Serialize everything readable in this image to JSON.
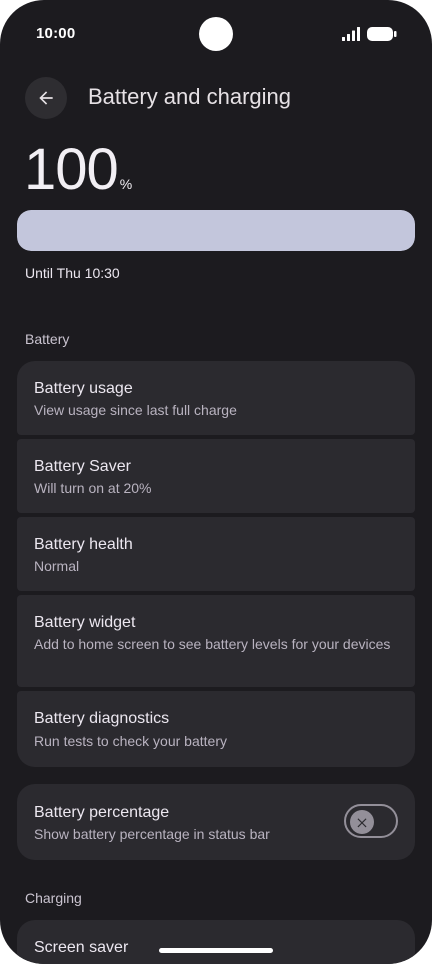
{
  "status_bar": {
    "time": "10:00"
  },
  "header": {
    "title": "Battery and charging",
    "back_icon": "arrow-back-icon"
  },
  "battery": {
    "level_value": "100",
    "level_unit": "%",
    "level_fraction": 1.0,
    "until_text": "Until Thu 10:30",
    "fill_color": "#c3c6dc"
  },
  "sections": {
    "battery_label": "Battery",
    "charging_label": "Charging"
  },
  "battery_items": [
    {
      "title": "Battery usage",
      "subtitle": "View usage since last full charge"
    },
    {
      "title": "Battery Saver",
      "subtitle": "Will turn on at 20%"
    },
    {
      "title": "Battery health",
      "subtitle": "Normal"
    },
    {
      "title": "Battery widget",
      "subtitle": "Add to home screen to see battery levels for your devices"
    },
    {
      "title": "Battery diagnostics",
      "subtitle": "Run tests to check your battery"
    }
  ],
  "battery_percentage": {
    "title": "Battery percentage",
    "subtitle": "Show battery percentage in status bar",
    "enabled": false,
    "toggle_icon": "close-icon"
  },
  "charging_items": [
    {
      "title": "Screen saver"
    }
  ]
}
